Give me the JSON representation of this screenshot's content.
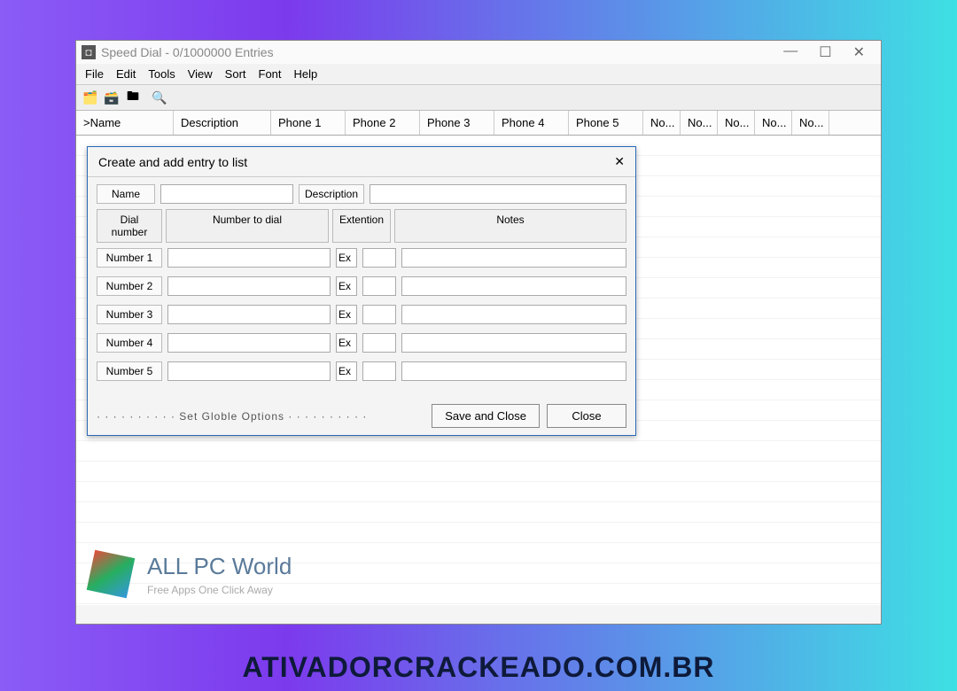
{
  "window": {
    "title": "Speed Dial - 0/1000000 Entries",
    "controls": {
      "min": "—",
      "max": "☐",
      "close": "✕"
    }
  },
  "menubar": [
    "File",
    "Edit",
    "Tools",
    "View",
    "Sort",
    "Font",
    "Help"
  ],
  "toolbar_icons": [
    "tool1",
    "tool2",
    "tool3",
    "tool4"
  ],
  "columns": [
    ">Name",
    "Description",
    "Phone 1",
    "Phone 2",
    "Phone 3",
    "Phone 4",
    "Phone 5",
    "No...",
    "No...",
    "No...",
    "No...",
    "No..."
  ],
  "dialog": {
    "title": "Create and add entry to list",
    "close_glyph": "✕",
    "name_label": "Name",
    "description_label": "Description",
    "headers": {
      "dial_number": "Dial number",
      "number_to_dial": "Number to dial",
      "extention": "Extention",
      "notes": "Notes"
    },
    "rows": [
      {
        "label": "Number 1",
        "ext": "Ex"
      },
      {
        "label": "Number 2",
        "ext": "Ex"
      },
      {
        "label": "Number 3",
        "ext": "Ex"
      },
      {
        "label": "Number 4",
        "ext": "Ex"
      },
      {
        "label": "Number 5",
        "ext": "Ex"
      }
    ],
    "global_options": "· · · · · · · · · · Set Globle Options · · · · · · · · · ·",
    "save_label": "Save and Close",
    "close_label": "Close"
  },
  "brand": {
    "title": "ALL PC World",
    "subtitle": "Free Apps One Click Away"
  },
  "page_footer": "ATIVADORCRACKEADO.COM.BR"
}
